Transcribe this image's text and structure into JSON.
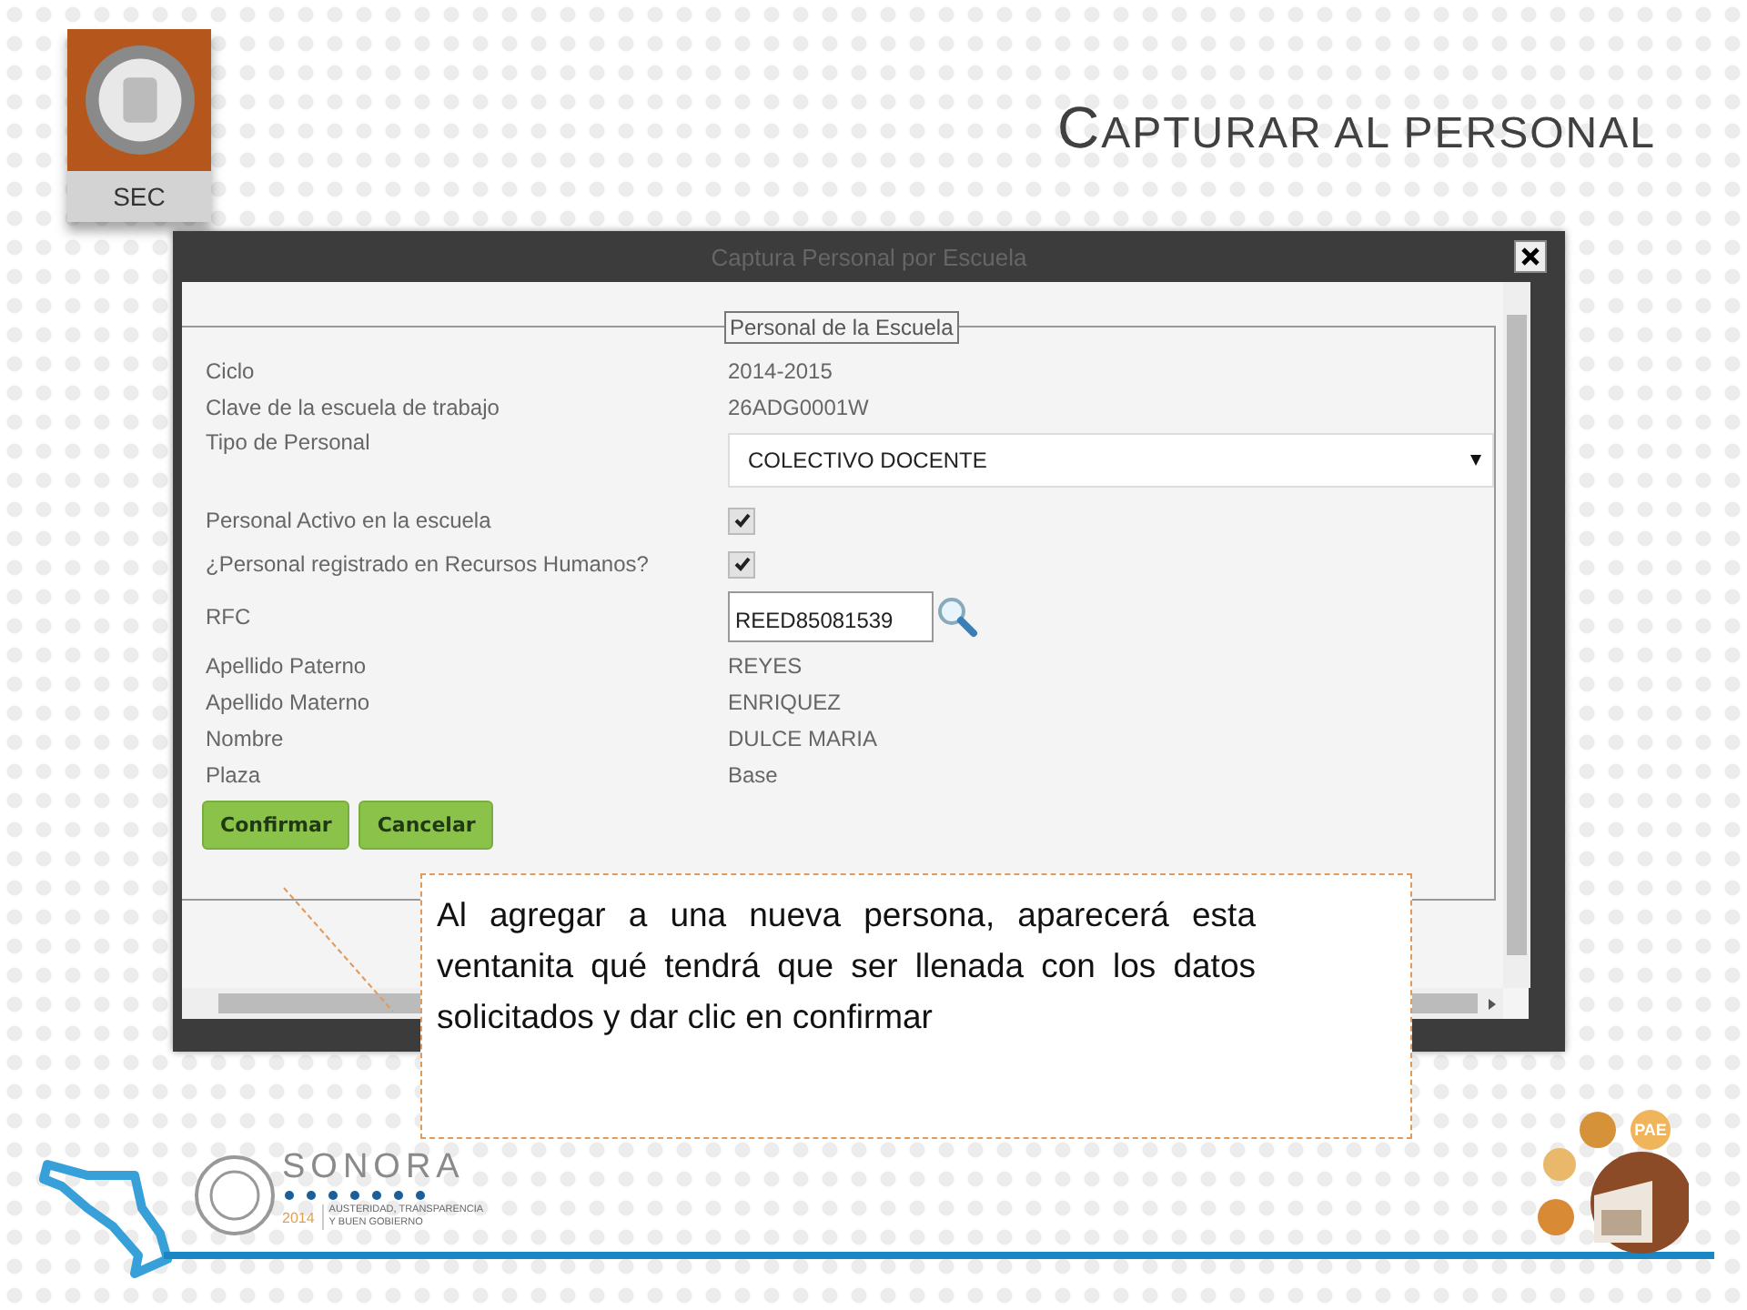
{
  "slide": {
    "logo_label": "SEC",
    "title": "CAPTURAR AL PERSONAL"
  },
  "dialog": {
    "title": "Captura Personal por Escuela",
    "legend": "Personal de la Escuela",
    "fields": [
      {
        "kind": "text",
        "label": "Ciclo",
        "value": "2014-2015"
      },
      {
        "kind": "text",
        "label": "Clave de la escuela de trabajo",
        "value": "26ADG0001W"
      },
      {
        "kind": "select",
        "label": "Tipo de Personal",
        "value": "COLECTIVO DOCENTE"
      },
      {
        "kind": "checkbox",
        "label": "Personal Activo en la escuela",
        "checked": true
      },
      {
        "kind": "checkbox",
        "label": "¿Personal registrado en Recursos Humanos?",
        "checked": true
      },
      {
        "kind": "input",
        "label": "RFC",
        "value": "REED85081539"
      },
      {
        "kind": "text",
        "label": "Apellido Paterno",
        "value": "REYES"
      },
      {
        "kind": "text",
        "label": "Apellido Materno",
        "value": "ENRIQUEZ"
      },
      {
        "kind": "text",
        "label": "Nombre",
        "value": "DULCE MARIA"
      },
      {
        "kind": "text",
        "label": "Plaza",
        "value": "Base"
      }
    ],
    "buttons": [
      "Confirmar",
      "Cancelar"
    ]
  },
  "callout": {
    "text": "Al agregar a una nueva persona, aparecerá esta ventanita qué tendrá que ser llenada con los datos solicitados y dar clic en confirmar"
  },
  "footer": {
    "brand": "SONORA",
    "year": "2014",
    "motto_1": "AUSTERIDAD, TRANSPARENCIA",
    "motto_2": "Y BUEN GOBIERNO",
    "badge": "PAE"
  }
}
